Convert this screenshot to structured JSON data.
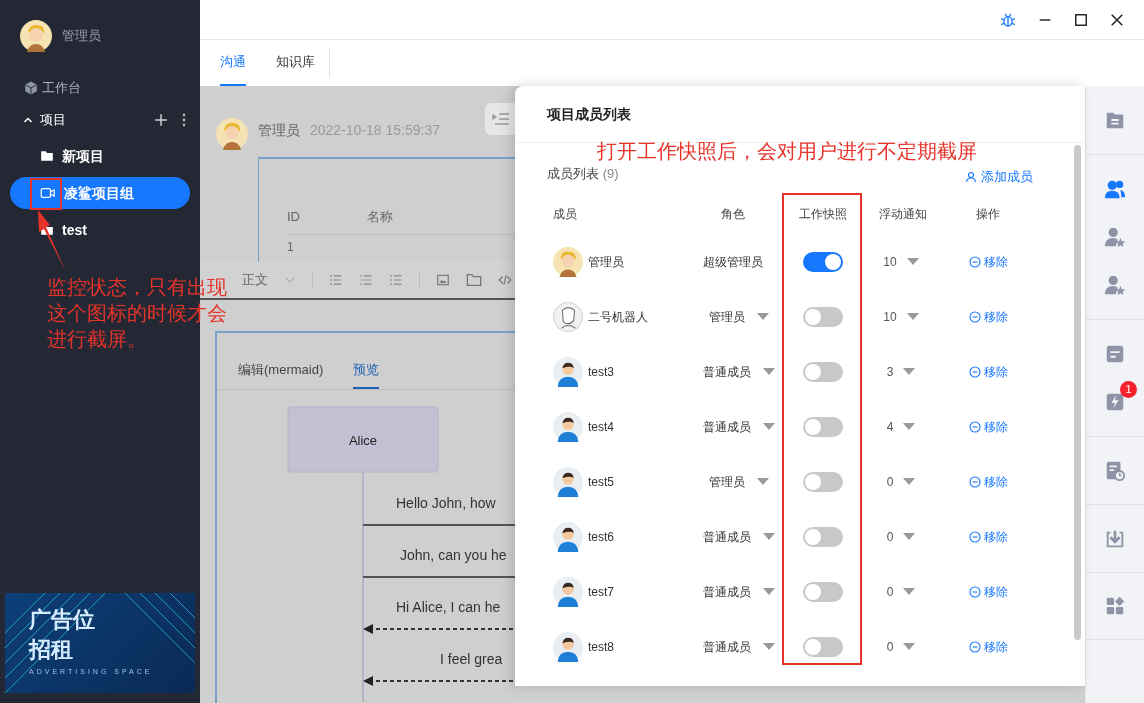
{
  "sidebar": {
    "user": {
      "name": "管理员",
      "avatar": {
        "kind": "cartoon"
      }
    },
    "nav": [
      {
        "label": "工作台"
      }
    ],
    "projects_section": {
      "label": "项目",
      "expanded": true,
      "items": [
        {
          "label": "新项目",
          "kind": "folder",
          "selected": false
        },
        {
          "label": "凌鲨项目组",
          "kind": "monitor",
          "selected": true
        },
        {
          "label": "test",
          "kind": "folder",
          "selected": false
        }
      ]
    },
    "annotation": {
      "text": "监控状态，只有出现这个图标的时候才会进行截屏。"
    },
    "ad": {
      "title": [
        "广告位",
        "招租"
      ],
      "subtitle": "ADVERTISING SPACE"
    }
  },
  "tabs": [
    {
      "label": "沟通",
      "selected": true
    },
    {
      "label": "知识库",
      "selected": false
    }
  ],
  "message": {
    "author": "管理员",
    "time": "2022-10-18 15:59:37",
    "avatar": {
      "kind": "cartoon"
    },
    "table": {
      "columns": [
        "ID",
        "名称"
      ],
      "rows": [
        [
          "1"
        ]
      ]
    },
    "toolbar": {
      "style": "正文"
    },
    "diagram_tabs": [
      {
        "label": "编辑(mermaid)",
        "selected": false
      },
      {
        "label": "预览",
        "selected": true
      }
    ],
    "participant": "Alice",
    "messages": [
      {
        "text": "Hello John, how",
        "kind": "solid"
      },
      {
        "text": "John, can you he",
        "kind": "solid"
      },
      {
        "text": "Hi Alice, I can he",
        "kind": "dashed"
      },
      {
        "text": "I feel grea",
        "kind": "dashed"
      }
    ]
  },
  "member_panel": {
    "title": "项目成员列表",
    "annotation": {
      "text": "打开工作快照后，会对用户进行不定期截屏"
    },
    "list_label": "成员列表",
    "count": "(9)",
    "add_button": "添加成员",
    "columns": [
      "成员",
      "角色",
      "工作快照",
      "浮动通知",
      "操作"
    ],
    "members": [
      {
        "name": "管理员",
        "avatar": {
          "kind": "cartoon"
        },
        "role": "超级管理员",
        "role_editable": false,
        "snapshot": true,
        "notify": "10",
        "action": "移除"
      },
      {
        "name": "二号机器人",
        "avatar": {
          "kind": "robot"
        },
        "role": "管理员",
        "role_editable": true,
        "snapshot": false,
        "notify": "10",
        "action": "移除"
      },
      {
        "name": "test3",
        "avatar": {
          "kind": "person"
        },
        "role": "普通成员",
        "role_editable": true,
        "snapshot": false,
        "notify": "3",
        "action": "移除"
      },
      {
        "name": "test4",
        "avatar": {
          "kind": "person"
        },
        "role": "普通成员",
        "role_editable": true,
        "snapshot": false,
        "notify": "4",
        "action": "移除"
      },
      {
        "name": "test5",
        "avatar": {
          "kind": "person"
        },
        "role": "管理员",
        "role_editable": true,
        "snapshot": false,
        "notify": "0",
        "action": "移除"
      },
      {
        "name": "test6",
        "avatar": {
          "kind": "person"
        },
        "role": "普通成员",
        "role_editable": true,
        "snapshot": false,
        "notify": "0",
        "action": "移除"
      },
      {
        "name": "test7",
        "avatar": {
          "kind": "person"
        },
        "role": "普通成员",
        "role_editable": true,
        "snapshot": false,
        "notify": "0",
        "action": "移除"
      },
      {
        "name": "test8",
        "avatar": {
          "kind": "person"
        },
        "role": "普通成员",
        "role_editable": true,
        "snapshot": false,
        "notify": "0",
        "action": "移除"
      }
    ]
  },
  "right_rail": {
    "groups": [
      {
        "items": [
          {
            "kind": "doc-folder",
            "selected": false
          }
        ]
      },
      {
        "items": [
          {
            "kind": "users",
            "selected": true
          },
          {
            "kind": "user-star",
            "selected": false
          },
          {
            "kind": "user-star",
            "selected": false
          }
        ]
      },
      {
        "items": [
          {
            "kind": "doc",
            "selected": false
          },
          {
            "kind": "flash",
            "selected": false,
            "badge": "1"
          }
        ]
      },
      {
        "items": [
          {
            "kind": "schedule",
            "selected": false
          }
        ]
      },
      {
        "items": [
          {
            "kind": "download",
            "selected": false
          }
        ]
      },
      {
        "items": [
          {
            "kind": "apps",
            "selected": false
          }
        ]
      }
    ]
  }
}
